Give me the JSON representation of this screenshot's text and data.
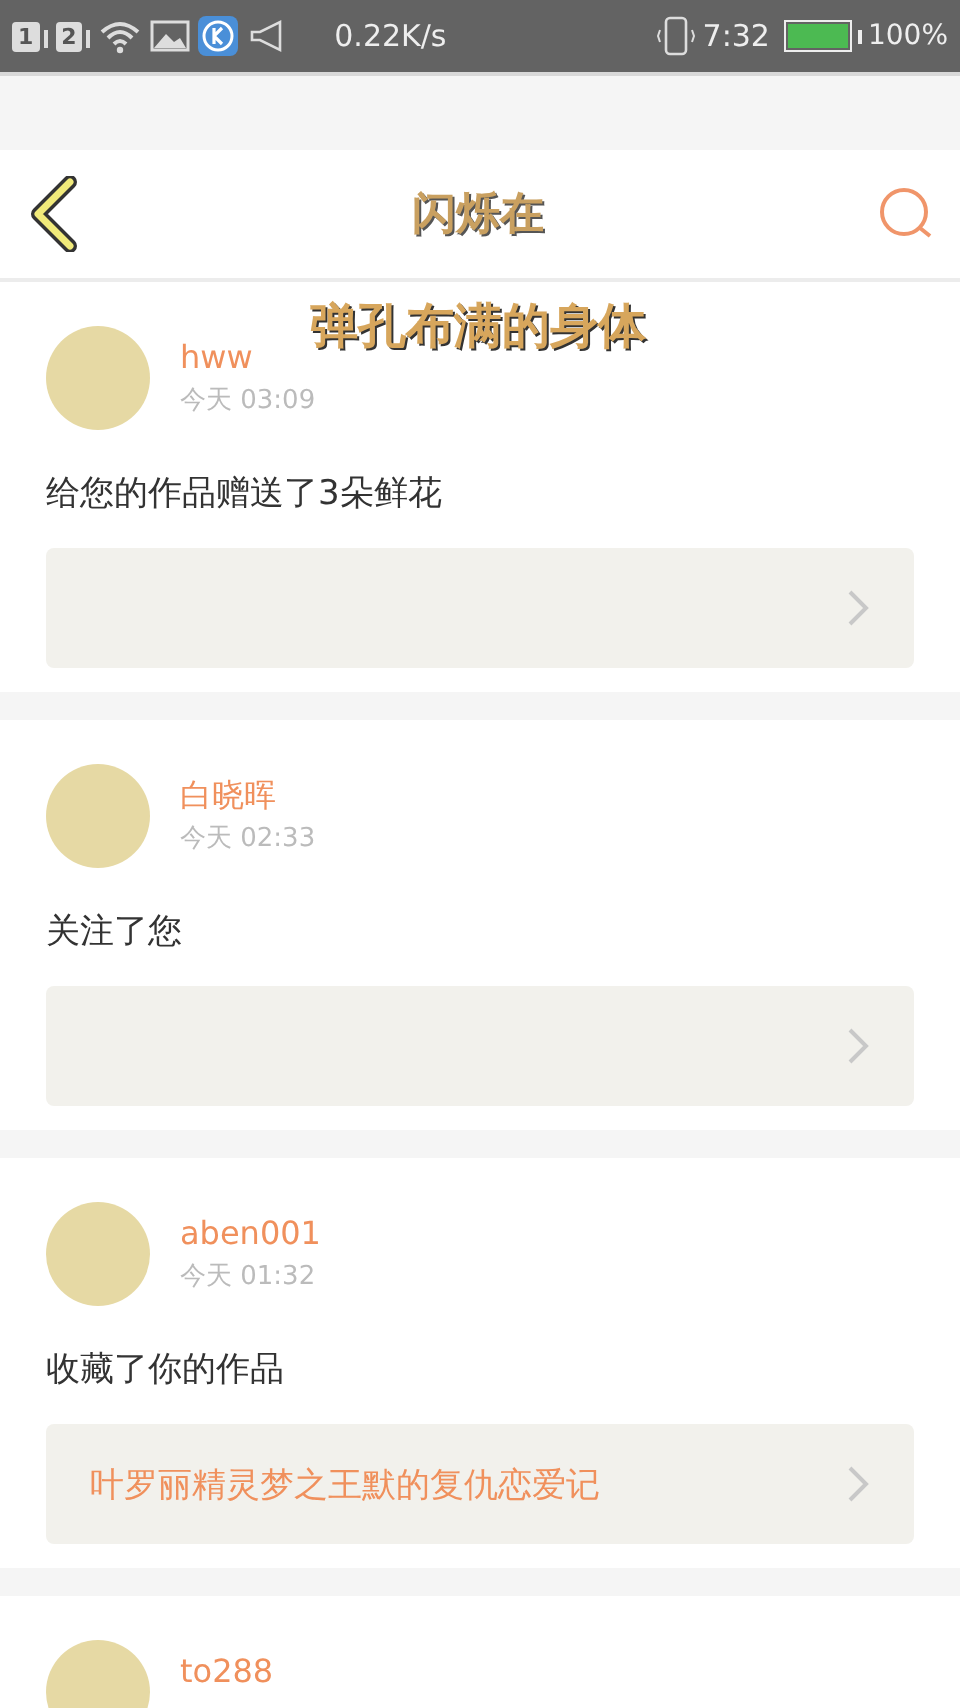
{
  "status_bar": {
    "sim_slots": [
      "1",
      "2"
    ],
    "net_speed": "0.22K/s",
    "time": "7:32",
    "battery": {
      "level": 1.0,
      "text": "100%"
    }
  },
  "header": {
    "title": "闪烁在",
    "subtitle": "弹孔布满的身体"
  },
  "feed": [
    {
      "user": "hww",
      "time": "今天 03:09",
      "message": "给您的作品赠送了3朵鲜花",
      "link": {
        "shown": true
      }
    },
    {
      "user": "白晓晖",
      "time": "今天 02:33",
      "message": "关注了您",
      "link": {
        "shown": true
      }
    },
    {
      "user": "aben001",
      "time": "今天 01:32",
      "message": "收藏了你的作品",
      "link": {
        "shown": true,
        "text": "叶罗丽精灵梦之王默的复仇恋爱记"
      }
    },
    {
      "user": "to288"
    }
  ]
}
